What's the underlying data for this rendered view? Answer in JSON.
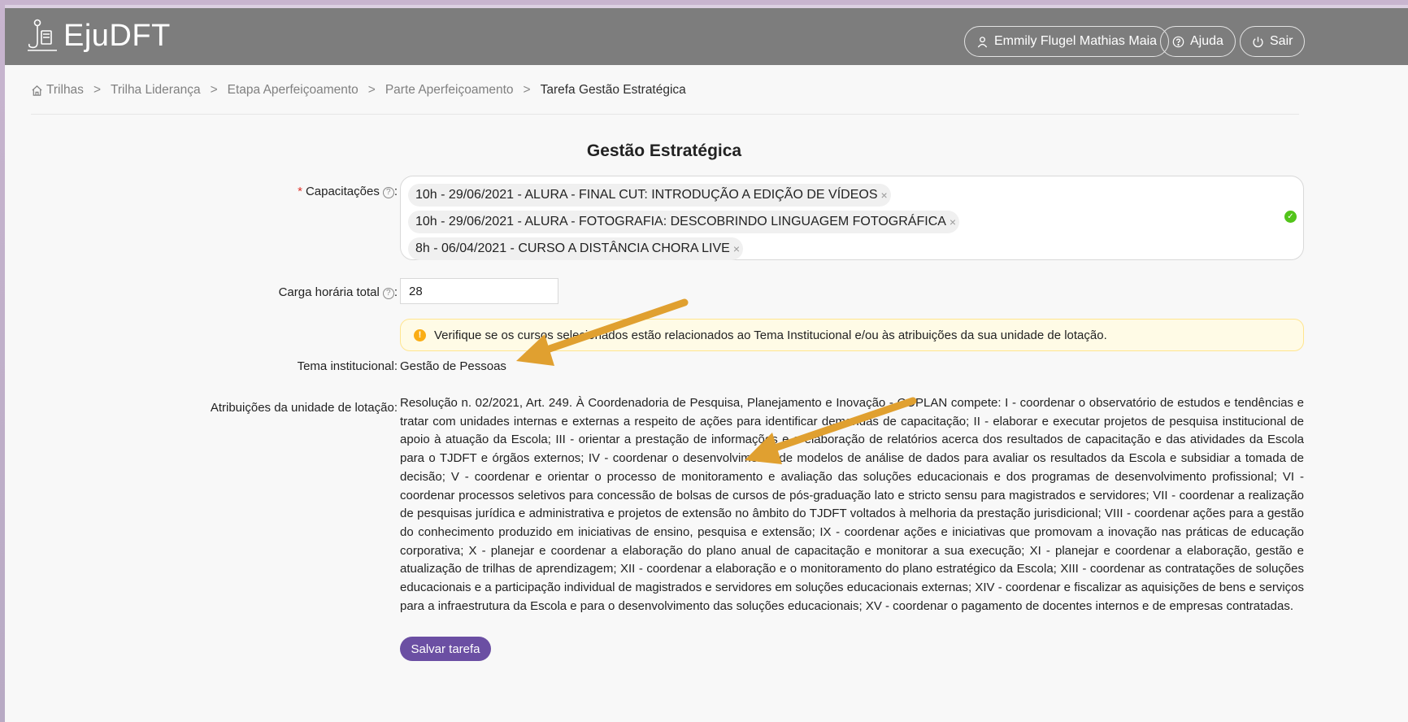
{
  "app": {
    "logo_text": "EjuDFT"
  },
  "header": {
    "user_label": "Emmily Flugel Mathias Maia",
    "help_label": "Ajuda",
    "logout_label": "Sair"
  },
  "breadcrumb": [
    "Trilhas",
    "Trilha Liderança",
    "Etapa Aperfeiçoamento",
    "Parte Aperfeiçoamento",
    "Tarefa Gestão Estratégica"
  ],
  "breadcrumb_separator": ">",
  "page": {
    "title": "Gestão Estratégica"
  },
  "form": {
    "capacitacoes_label": "Capacitações",
    "capacitacoes_required_mark": "*",
    "capacitacoes": [
      "10h - 29/06/2021 - ALURA - FINAL CUT: INTRODUÇÃO A EDIÇÃO DE VÍDEOS",
      "10h - 29/06/2021 - ALURA - FOTOGRAFIA: DESCOBRINDO LINGUAGEM FOTOGRÁFICA",
      "8h - 06/04/2021 - CURSO A DISTÂNCIA CHORA LIVE"
    ],
    "carga_label": "Carga horária total",
    "carga_value": "28",
    "alert_text": "Verifique se os cursos selecionados estão relacionados ao Tema Institucional e/ou às atribuições da sua unidade de lotação.",
    "tema_label": "Tema institucional",
    "tema_value": "Gestão de Pessoas",
    "atribuicoes_label": "Atribuições da unidade de lotação",
    "atribuicoes_value": "Resolução n. 02/2021, Art. 249. À Coordenadoria de Pesquisa, Planejamento e Inovação - COPLAN compete: I - coordenar o observatório de estudos e tendências e tratar com unidades internas e externas a respeito de ações para identificar demandas de capacitação; II - elaborar e executar projetos de pesquisa institucional de apoio à atuação da Escola; III - orientar a prestação de informações e a elaboração de relatórios acerca dos resultados de capacitação e das atividades da Escola para o TJDFT e órgãos externos; IV - coordenar o desenvolvimento de modelos de análise de dados para avaliar os resultados da Escola e subsidiar a tomada de decisão; V - coordenar e orientar o processo de monitoramento e avaliação das soluções educacionais e dos programas de desenvolvimento profissional; VI - coordenar processos seletivos para concessão de bolsas de cursos de pós-graduação lato e stricto sensu para magistrados e servidores; VII - coordenar a realização de pesquisas jurídica e administrativa e projetos de extensão no âmbito do TJDFT voltados à melhoria da prestação jurisdicional; VIII - coordenar ações para a gestão do conhecimento produzido em iniciativas de ensino, pesquisa e extensão; IX - coordenar ações e iniciativas que promovam a inovação nas práticas de educação corporativa; X - planejar e coordenar a elaboração do plano anual de capacitação e monitorar a sua execução; XI - planejar e coordenar a elaboração, gestão e atualização de trilhas de aprendizagem; XII - coordenar a elaboração e o monitoramento do plano estratégico da Escola; XIII - coordenar as contratações de soluções educacionais e a participação individual de magistrados e servidores em soluções educacionais externas; XIV - coordenar e fiscalizar as aquisições de bens e serviços para a infraestrutura da Escola e para o desenvolvimento das soluções educacionais; XV - coordenar o pagamento de docentes internos e de empresas contratadas.",
    "label_colon": ":",
    "save_label": "Salvar tarefa"
  },
  "colors": {
    "header_bg": "#7d7d7d",
    "primary": "#6b4fa3",
    "annotation_arrow": "#e0a030",
    "success": "#52c41a",
    "warning": "#faad14"
  }
}
